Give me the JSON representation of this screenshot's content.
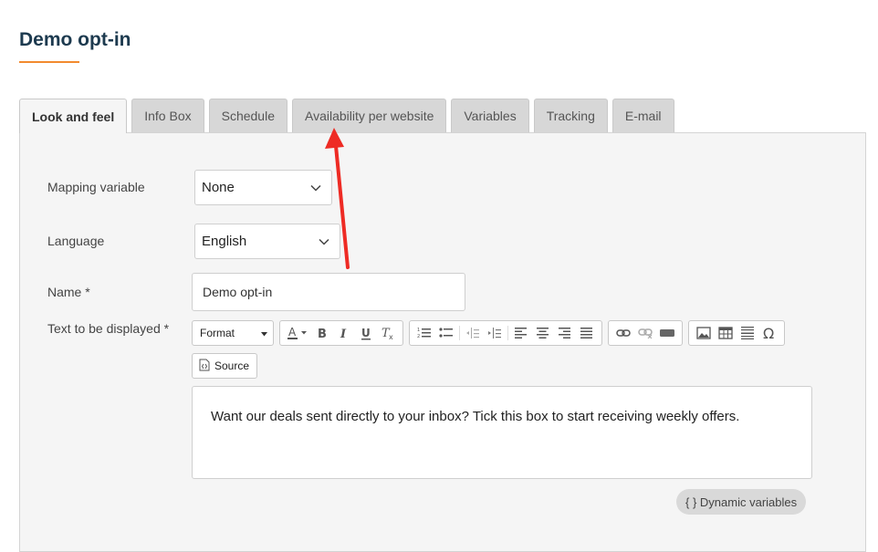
{
  "page": {
    "title": "Demo opt-in",
    "accent_color": "#f28a2e",
    "title_color": "#1d3a4f"
  },
  "tabs": [
    {
      "label": "Look and feel",
      "active": true
    },
    {
      "label": "Info Box"
    },
    {
      "label": "Schedule"
    },
    {
      "label": "Availability per website"
    },
    {
      "label": "Variables"
    },
    {
      "label": "Tracking"
    },
    {
      "label": "E-mail"
    }
  ],
  "form": {
    "mapping_variable": {
      "label": "Mapping variable",
      "value": "None"
    },
    "language": {
      "label": "Language",
      "value": "English"
    },
    "name": {
      "label": "Name *",
      "value": "Demo opt-in"
    },
    "text": {
      "label": "Text to be displayed *"
    }
  },
  "toolbar": {
    "format_label": "Format",
    "source_label": "Source",
    "icons": [
      "text-color-icon",
      "bold-icon",
      "italic-icon",
      "underline-icon",
      "remove-format-icon",
      "numbered-list-icon",
      "bulleted-list-icon",
      "outdent-icon",
      "indent-icon",
      "align-left-icon",
      "align-center-icon",
      "align-right-icon",
      "justify-icon",
      "link-icon",
      "unlink-icon",
      "anchor-icon",
      "image-icon",
      "table-icon",
      "horizontal-line-icon",
      "special-character-icon"
    ]
  },
  "editor": {
    "content": "Want our deals sent directly to your inbox? Tick this box to start receiving weekly offers."
  },
  "dynamic_variables": {
    "label": "{ } Dynamic variables"
  },
  "annotation": {
    "color": "#ee2b24"
  }
}
